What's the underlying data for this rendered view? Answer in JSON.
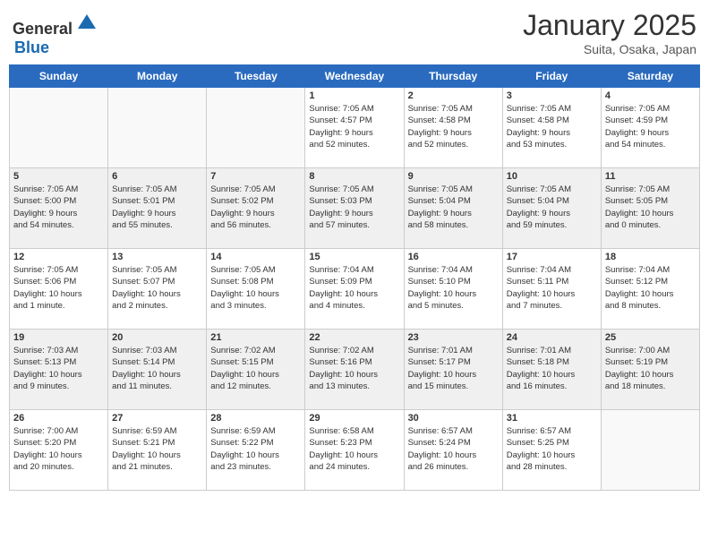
{
  "header": {
    "logo_general": "General",
    "logo_blue": "Blue",
    "month": "January 2025",
    "location": "Suita, Osaka, Japan"
  },
  "weekdays": [
    "Sunday",
    "Monday",
    "Tuesday",
    "Wednesday",
    "Thursday",
    "Friday",
    "Saturday"
  ],
  "weeks": [
    [
      {
        "day": "",
        "info": ""
      },
      {
        "day": "",
        "info": ""
      },
      {
        "day": "",
        "info": ""
      },
      {
        "day": "1",
        "info": "Sunrise: 7:05 AM\nSunset: 4:57 PM\nDaylight: 9 hours\nand 52 minutes."
      },
      {
        "day": "2",
        "info": "Sunrise: 7:05 AM\nSunset: 4:58 PM\nDaylight: 9 hours\nand 52 minutes."
      },
      {
        "day": "3",
        "info": "Sunrise: 7:05 AM\nSunset: 4:58 PM\nDaylight: 9 hours\nand 53 minutes."
      },
      {
        "day": "4",
        "info": "Sunrise: 7:05 AM\nSunset: 4:59 PM\nDaylight: 9 hours\nand 54 minutes."
      }
    ],
    [
      {
        "day": "5",
        "info": "Sunrise: 7:05 AM\nSunset: 5:00 PM\nDaylight: 9 hours\nand 54 minutes."
      },
      {
        "day": "6",
        "info": "Sunrise: 7:05 AM\nSunset: 5:01 PM\nDaylight: 9 hours\nand 55 minutes."
      },
      {
        "day": "7",
        "info": "Sunrise: 7:05 AM\nSunset: 5:02 PM\nDaylight: 9 hours\nand 56 minutes."
      },
      {
        "day": "8",
        "info": "Sunrise: 7:05 AM\nSunset: 5:03 PM\nDaylight: 9 hours\nand 57 minutes."
      },
      {
        "day": "9",
        "info": "Sunrise: 7:05 AM\nSunset: 5:04 PM\nDaylight: 9 hours\nand 58 minutes."
      },
      {
        "day": "10",
        "info": "Sunrise: 7:05 AM\nSunset: 5:04 PM\nDaylight: 9 hours\nand 59 minutes."
      },
      {
        "day": "11",
        "info": "Sunrise: 7:05 AM\nSunset: 5:05 PM\nDaylight: 10 hours\nand 0 minutes."
      }
    ],
    [
      {
        "day": "12",
        "info": "Sunrise: 7:05 AM\nSunset: 5:06 PM\nDaylight: 10 hours\nand 1 minute."
      },
      {
        "day": "13",
        "info": "Sunrise: 7:05 AM\nSunset: 5:07 PM\nDaylight: 10 hours\nand 2 minutes."
      },
      {
        "day": "14",
        "info": "Sunrise: 7:05 AM\nSunset: 5:08 PM\nDaylight: 10 hours\nand 3 minutes."
      },
      {
        "day": "15",
        "info": "Sunrise: 7:04 AM\nSunset: 5:09 PM\nDaylight: 10 hours\nand 4 minutes."
      },
      {
        "day": "16",
        "info": "Sunrise: 7:04 AM\nSunset: 5:10 PM\nDaylight: 10 hours\nand 5 minutes."
      },
      {
        "day": "17",
        "info": "Sunrise: 7:04 AM\nSunset: 5:11 PM\nDaylight: 10 hours\nand 7 minutes."
      },
      {
        "day": "18",
        "info": "Sunrise: 7:04 AM\nSunset: 5:12 PM\nDaylight: 10 hours\nand 8 minutes."
      }
    ],
    [
      {
        "day": "19",
        "info": "Sunrise: 7:03 AM\nSunset: 5:13 PM\nDaylight: 10 hours\nand 9 minutes."
      },
      {
        "day": "20",
        "info": "Sunrise: 7:03 AM\nSunset: 5:14 PM\nDaylight: 10 hours\nand 11 minutes."
      },
      {
        "day": "21",
        "info": "Sunrise: 7:02 AM\nSunset: 5:15 PM\nDaylight: 10 hours\nand 12 minutes."
      },
      {
        "day": "22",
        "info": "Sunrise: 7:02 AM\nSunset: 5:16 PM\nDaylight: 10 hours\nand 13 minutes."
      },
      {
        "day": "23",
        "info": "Sunrise: 7:01 AM\nSunset: 5:17 PM\nDaylight: 10 hours\nand 15 minutes."
      },
      {
        "day": "24",
        "info": "Sunrise: 7:01 AM\nSunset: 5:18 PM\nDaylight: 10 hours\nand 16 minutes."
      },
      {
        "day": "25",
        "info": "Sunrise: 7:00 AM\nSunset: 5:19 PM\nDaylight: 10 hours\nand 18 minutes."
      }
    ],
    [
      {
        "day": "26",
        "info": "Sunrise: 7:00 AM\nSunset: 5:20 PM\nDaylight: 10 hours\nand 20 minutes."
      },
      {
        "day": "27",
        "info": "Sunrise: 6:59 AM\nSunset: 5:21 PM\nDaylight: 10 hours\nand 21 minutes."
      },
      {
        "day": "28",
        "info": "Sunrise: 6:59 AM\nSunset: 5:22 PM\nDaylight: 10 hours\nand 23 minutes."
      },
      {
        "day": "29",
        "info": "Sunrise: 6:58 AM\nSunset: 5:23 PM\nDaylight: 10 hours\nand 24 minutes."
      },
      {
        "day": "30",
        "info": "Sunrise: 6:57 AM\nSunset: 5:24 PM\nDaylight: 10 hours\nand 26 minutes."
      },
      {
        "day": "31",
        "info": "Sunrise: 6:57 AM\nSunset: 5:25 PM\nDaylight: 10 hours\nand 28 minutes."
      },
      {
        "day": "",
        "info": ""
      }
    ]
  ]
}
